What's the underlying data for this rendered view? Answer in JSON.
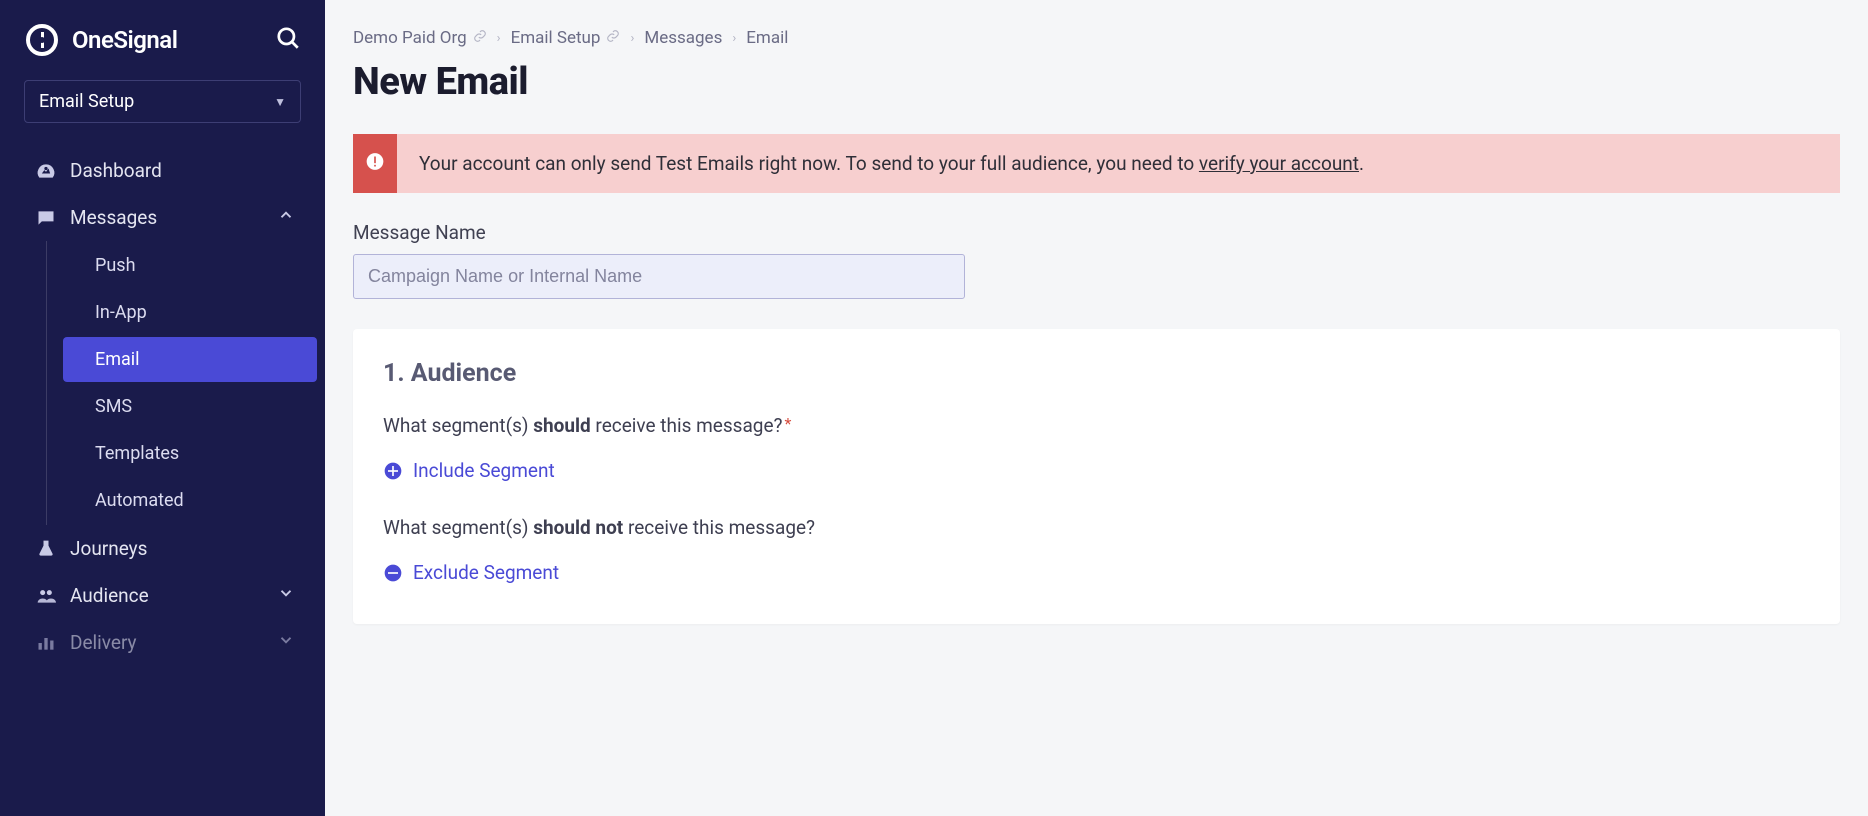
{
  "brand": {
    "name": "OneSignal"
  },
  "appSelector": {
    "label": "Email Setup"
  },
  "nav": {
    "dashboard": "Dashboard",
    "messages": "Messages",
    "sub": {
      "push": "Push",
      "inapp": "In-App",
      "email": "Email",
      "sms": "SMS",
      "templates": "Templates",
      "automated": "Automated"
    },
    "journeys": "Journeys",
    "audience": "Audience",
    "delivery": "Delivery"
  },
  "breadcrumb": {
    "org": "Demo Paid Org",
    "setup": "Email Setup",
    "messages": "Messages",
    "email": "Email"
  },
  "page": {
    "title": "New Email"
  },
  "alert": {
    "text": "Your account can only send Test Emails right now. To send to your full audience, you need to ",
    "link": "verify your account",
    "tail": "."
  },
  "form": {
    "msgNameLabel": "Message Name",
    "msgNamePlaceholder": "Campaign Name or Internal Name"
  },
  "audience": {
    "heading": "1. Audience",
    "include_q_pre": "What segment(s) ",
    "include_q_bold": "should",
    "include_q_post": " receive this message?",
    "include_action": "Include Segment",
    "exclude_q_pre": "What segment(s) ",
    "exclude_q_bold": "should not",
    "exclude_q_post": " receive this message?",
    "exclude_action": "Exclude Segment"
  }
}
